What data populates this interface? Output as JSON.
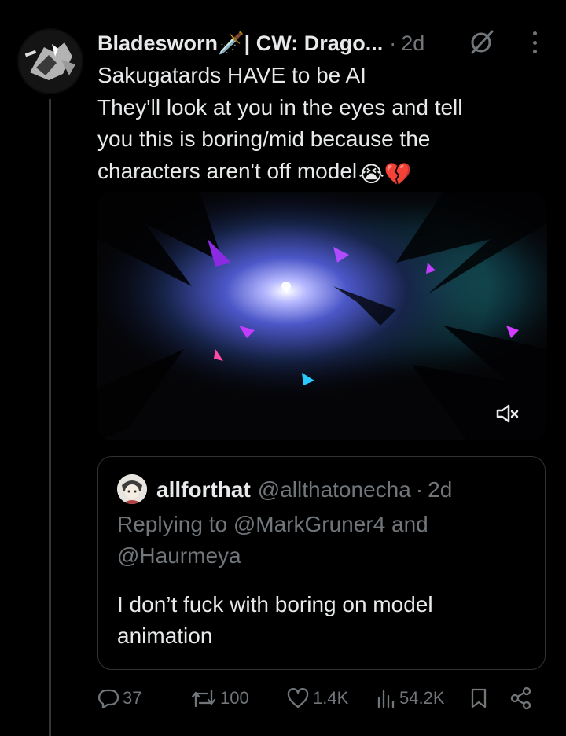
{
  "tweet": {
    "author_name": "Bladesworn🗡️| CW: Drago...",
    "separator": "·",
    "time": "2d",
    "text_lines": [
      "Sakugatards HAVE to be AI",
      "They'll look at you in the eyes and tell",
      "you this is boring/mid because the",
      "characters aren't off model"
    ],
    "text_emojis": "😭💔",
    "media": {
      "muted_icon": "volume-muted-icon"
    }
  },
  "quote": {
    "name": "allforthat",
    "handle": "@allthatonecha",
    "separator": "·",
    "time": "2d",
    "reply_lines": [
      "Replying to @MarkGruner4 and",
      "@Haurmeya"
    ],
    "text_lines": [
      "I don’t fuck with boring on model",
      "animation"
    ]
  },
  "actions": {
    "replies": "37",
    "reposts": "100",
    "likes": "1.4K",
    "views": "54.2K"
  },
  "icons": {
    "reply": "reply-icon",
    "repost": "repost-icon",
    "like": "heart-icon",
    "views": "views-icon",
    "bookmark": "bookmark-icon",
    "share": "share-icon",
    "grok": "grok-icon",
    "more": "more-icon"
  },
  "colors": {
    "background": "#000000",
    "text": "#e7e9ea",
    "muted": "#71767b",
    "border": "#2f3336"
  }
}
